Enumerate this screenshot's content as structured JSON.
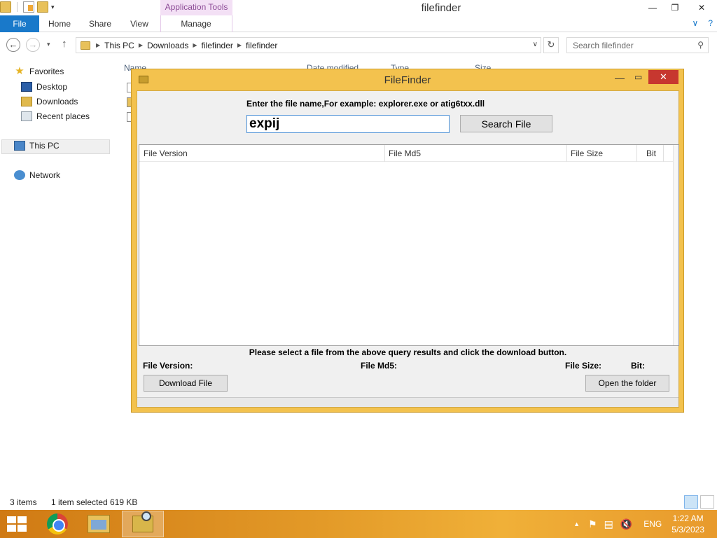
{
  "explorer": {
    "title": "filefinder",
    "contextual_tab": "Application Tools",
    "ribbon": {
      "file": "File",
      "home": "Home",
      "share": "Share",
      "view": "View",
      "manage": "Manage"
    },
    "breadcrumb": [
      "This PC",
      "Downloads",
      "filefinder",
      "filefinder"
    ],
    "search_placeholder": "Search filefinder",
    "nav": {
      "favorites": "Favorites",
      "desktop": "Desktop",
      "downloads": "Downloads",
      "recent": "Recent places",
      "thispc": "This PC",
      "network": "Network"
    },
    "columns": {
      "name": "Name",
      "date": "Date modified",
      "type": "Type",
      "size": "Size"
    },
    "status": {
      "items": "3 items",
      "selection": "1 item selected  619 KB"
    }
  },
  "filefinder": {
    "title": "FileFinder",
    "prompt": "Enter the file name,For example: explorer.exe or atig6txx.dll",
    "query": "expij",
    "search_button": "Search File",
    "columns": [
      "File Version",
      "File Md5",
      "File Size",
      "Bit"
    ],
    "hint": "Please select a file from the above query results and click the download button.",
    "info": {
      "version": "File Version:",
      "md5": "File Md5:",
      "size": "File Size:",
      "bit": "Bit:"
    },
    "download_button": "Download File",
    "open_folder_button": "Open the folder"
  },
  "taskbar": {
    "language": "ENG",
    "time": "1:22 AM",
    "date": "5/3/2023"
  },
  "colors": {
    "accent": "#1979ca",
    "dialog_frame": "#f3c24e",
    "close_button": "#c7372f",
    "contextual_tab": "#f3e0f5"
  }
}
